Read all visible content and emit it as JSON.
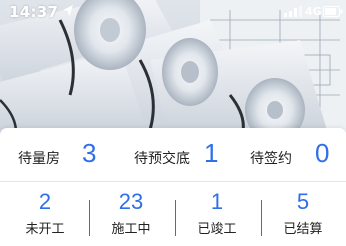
{
  "status_bar": {
    "time": "14:37",
    "network": "4G",
    "icons": [
      "location-arrow-icon",
      "signal-icon",
      "battery-icon"
    ]
  },
  "hero": {
    "image": "rolled-blueprints-illustration"
  },
  "summary": {
    "stats": [
      {
        "label": "待量房",
        "value": "3"
      },
      {
        "label": "待预交底",
        "value": "1"
      },
      {
        "label": "待签约",
        "value": "0"
      }
    ],
    "phases": [
      {
        "label": "未开工",
        "value": "2"
      },
      {
        "label": "施工中",
        "value": "23"
      },
      {
        "label": "已竣工",
        "value": "1"
      },
      {
        "label": "已结算",
        "value": "5"
      }
    ]
  },
  "colors": {
    "accent": "#2f6fe8",
    "text": "#222222",
    "divider": "#e4e6ea"
  }
}
